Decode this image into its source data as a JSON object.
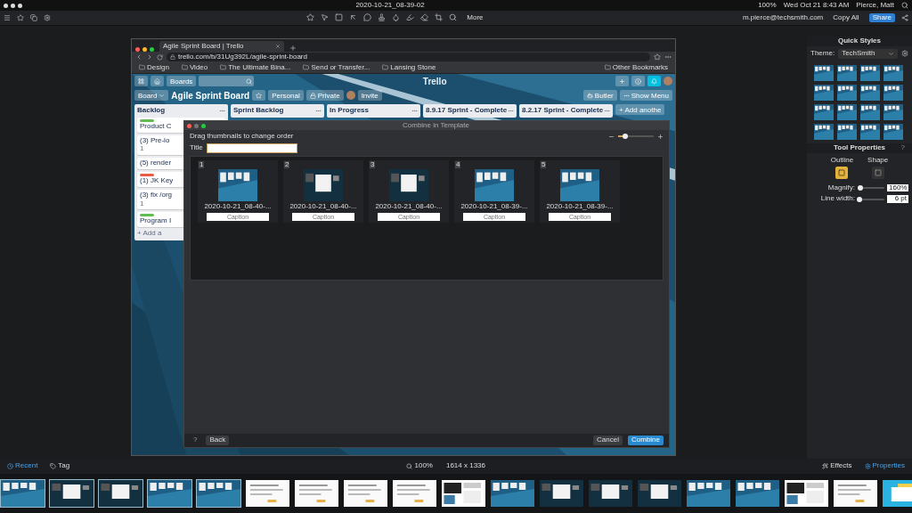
{
  "menu_bar": {
    "document_title": "2020-10-21_08-39-02",
    "battery": "100%",
    "clock": "Wed Oct 21  8:43 AM",
    "user": "Pierce, Matt"
  },
  "toolbar": {
    "more": "More",
    "account": "m.pierce@techsmith.com",
    "copy_all": "Copy All",
    "share": "Share"
  },
  "browser": {
    "tab_title": "Agile Sprint Board | Trello",
    "url": "trello.com/b/31Ug392L/agile-sprint-board",
    "bookmarks": [
      "Design",
      "Video",
      "The Ultimate Bina...",
      "Send or Transfer...",
      "Lansing Stone"
    ],
    "other_bookmarks": "Other Bookmarks"
  },
  "trello": {
    "boards": "Boards",
    "logo": "Trello",
    "board_menu": "Board",
    "board_title": "Agile Sprint Board",
    "personal": "Personal",
    "private": "Private",
    "invite": "Invite",
    "butler": "Butler",
    "show_menu": "Show Menu",
    "add_list": "+ Add anothe",
    "lists": [
      {
        "title": "Backlog"
      },
      {
        "title": "Sprint Backlog"
      },
      {
        "title": "In Progress"
      },
      {
        "title": "8.9.17 Sprint - Complete"
      },
      {
        "title": "8.2.17 Sprint - Complete"
      }
    ],
    "backlog_cards": [
      {
        "text": "Product C",
        "color": "#61bd4f"
      },
      {
        "text": "(3) Pre-lo",
        "badge": "1"
      },
      {
        "text": "(5) render"
      },
      {
        "text": "(1) JK Key",
        "color": "#eb5a46"
      },
      {
        "text": "(3) fix /org",
        "badge": "1"
      },
      {
        "text": "Program I",
        "color": "#61bd4f"
      }
    ],
    "add_card": "+ Add a"
  },
  "dialog": {
    "title": "Combine in Template",
    "hint": "Drag thumbnails to change order",
    "title_label": "Title",
    "zoom_slider": {
      "level": 0.2
    },
    "thumbnails": [
      {
        "number": "1",
        "name": "2020-10-21_08-40-...",
        "caption_placeholder": "Caption",
        "kind": "board"
      },
      {
        "number": "2",
        "name": "2020-10-21_08-40-...",
        "caption_placeholder": "Caption",
        "kind": "dialog"
      },
      {
        "number": "3",
        "name": "2020-10-21_08-40-...",
        "caption_placeholder": "Caption",
        "kind": "dialog"
      },
      {
        "number": "4",
        "name": "2020-10-21_08-39-...",
        "caption_placeholder": "Caption",
        "kind": "board"
      },
      {
        "number": "5",
        "name": "2020-10-21_08-39-...",
        "caption_placeholder": "Caption",
        "kind": "board"
      }
    ],
    "help": "?",
    "back": "Back",
    "cancel": "Cancel",
    "combine": "Combine"
  },
  "right_panel": {
    "quick_styles": "Quick Styles",
    "theme_label": "Theme:",
    "theme": "TechSmith",
    "tool_properties": "Tool Properties",
    "help": "?",
    "shapes": [
      {
        "label": "Outline",
        "selected": true
      },
      {
        "label": "Shape",
        "selected": false
      }
    ],
    "sliders": [
      {
        "label": "Magnify:",
        "level": 0.1,
        "value": "160%"
      },
      {
        "label": "Line width:",
        "level": 0.05,
        "value": "6 pt"
      }
    ]
  },
  "bottom_bar": {
    "recent": "Recent",
    "tag": "Tag",
    "zoom": "100%",
    "size": "1614 x 1336",
    "effects": "Effects",
    "properties": "Properties"
  },
  "tray": [
    {
      "selected": true,
      "kind": "board"
    },
    {
      "selected": true,
      "kind": "dialog"
    },
    {
      "selected": true,
      "kind": "dialog"
    },
    {
      "selected": true,
      "kind": "board"
    },
    {
      "selected": true,
      "kind": "board"
    },
    {
      "selected": false,
      "kind": "doc"
    },
    {
      "selected": false,
      "kind": "doc"
    },
    {
      "selected": false,
      "kind": "doc"
    },
    {
      "selected": false,
      "kind": "doc"
    },
    {
      "selected": false,
      "kind": "mixed"
    },
    {
      "selected": false,
      "kind": "board"
    },
    {
      "selected": false,
      "kind": "dialog"
    },
    {
      "selected": false,
      "kind": "dialog"
    },
    {
      "selected": false,
      "kind": "dialog"
    },
    {
      "selected": false,
      "kind": "board"
    },
    {
      "selected": false,
      "kind": "board"
    },
    {
      "selected": false,
      "kind": "mixed"
    },
    {
      "selected": false,
      "kind": "doc"
    },
    {
      "selected": false,
      "kind": "promo"
    }
  ]
}
